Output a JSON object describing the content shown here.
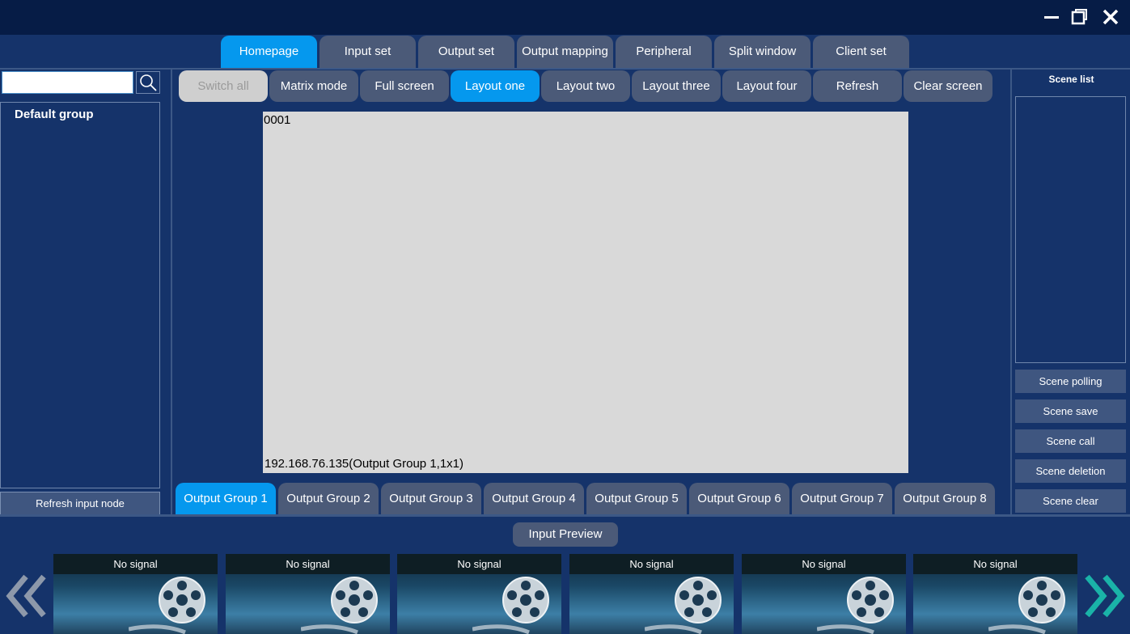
{
  "main_tabs": [
    "Homepage",
    "Input set",
    "Output set",
    "Output mapping",
    "Peripheral",
    "Split window",
    "Client set"
  ],
  "toolbar": [
    "Switch all",
    "Matrix mode",
    "Full screen",
    "Layout one",
    "Layout two",
    "Layout three",
    "Layout four",
    "Refresh",
    "Clear screen"
  ],
  "left": {
    "search_value": "",
    "group_label": "Default group",
    "refresh_label": "Refresh input node"
  },
  "canvas": {
    "window_id": "0001",
    "caption": "192.168.76.135(Output Group 1,1x1)"
  },
  "output_groups": [
    "Output Group 1",
    "Output Group 2",
    "Output Group 3",
    "Output Group 4",
    "Output Group 5",
    "Output Group 6",
    "Output Group 7",
    "Output Group 8"
  ],
  "scene": {
    "title": "Scene list",
    "buttons": [
      "Scene polling",
      "Scene save",
      "Scene call",
      "Scene deletion",
      "Scene clear"
    ]
  },
  "preview": {
    "button_label": "Input Preview",
    "thumbs": [
      "No signal",
      "No signal",
      "No signal",
      "No signal",
      "No signal",
      "No signal"
    ]
  },
  "colors": {
    "accent": "#0598ee",
    "background": "#15336a",
    "titlebar": "#061c46",
    "tab": "#4b5a78"
  }
}
